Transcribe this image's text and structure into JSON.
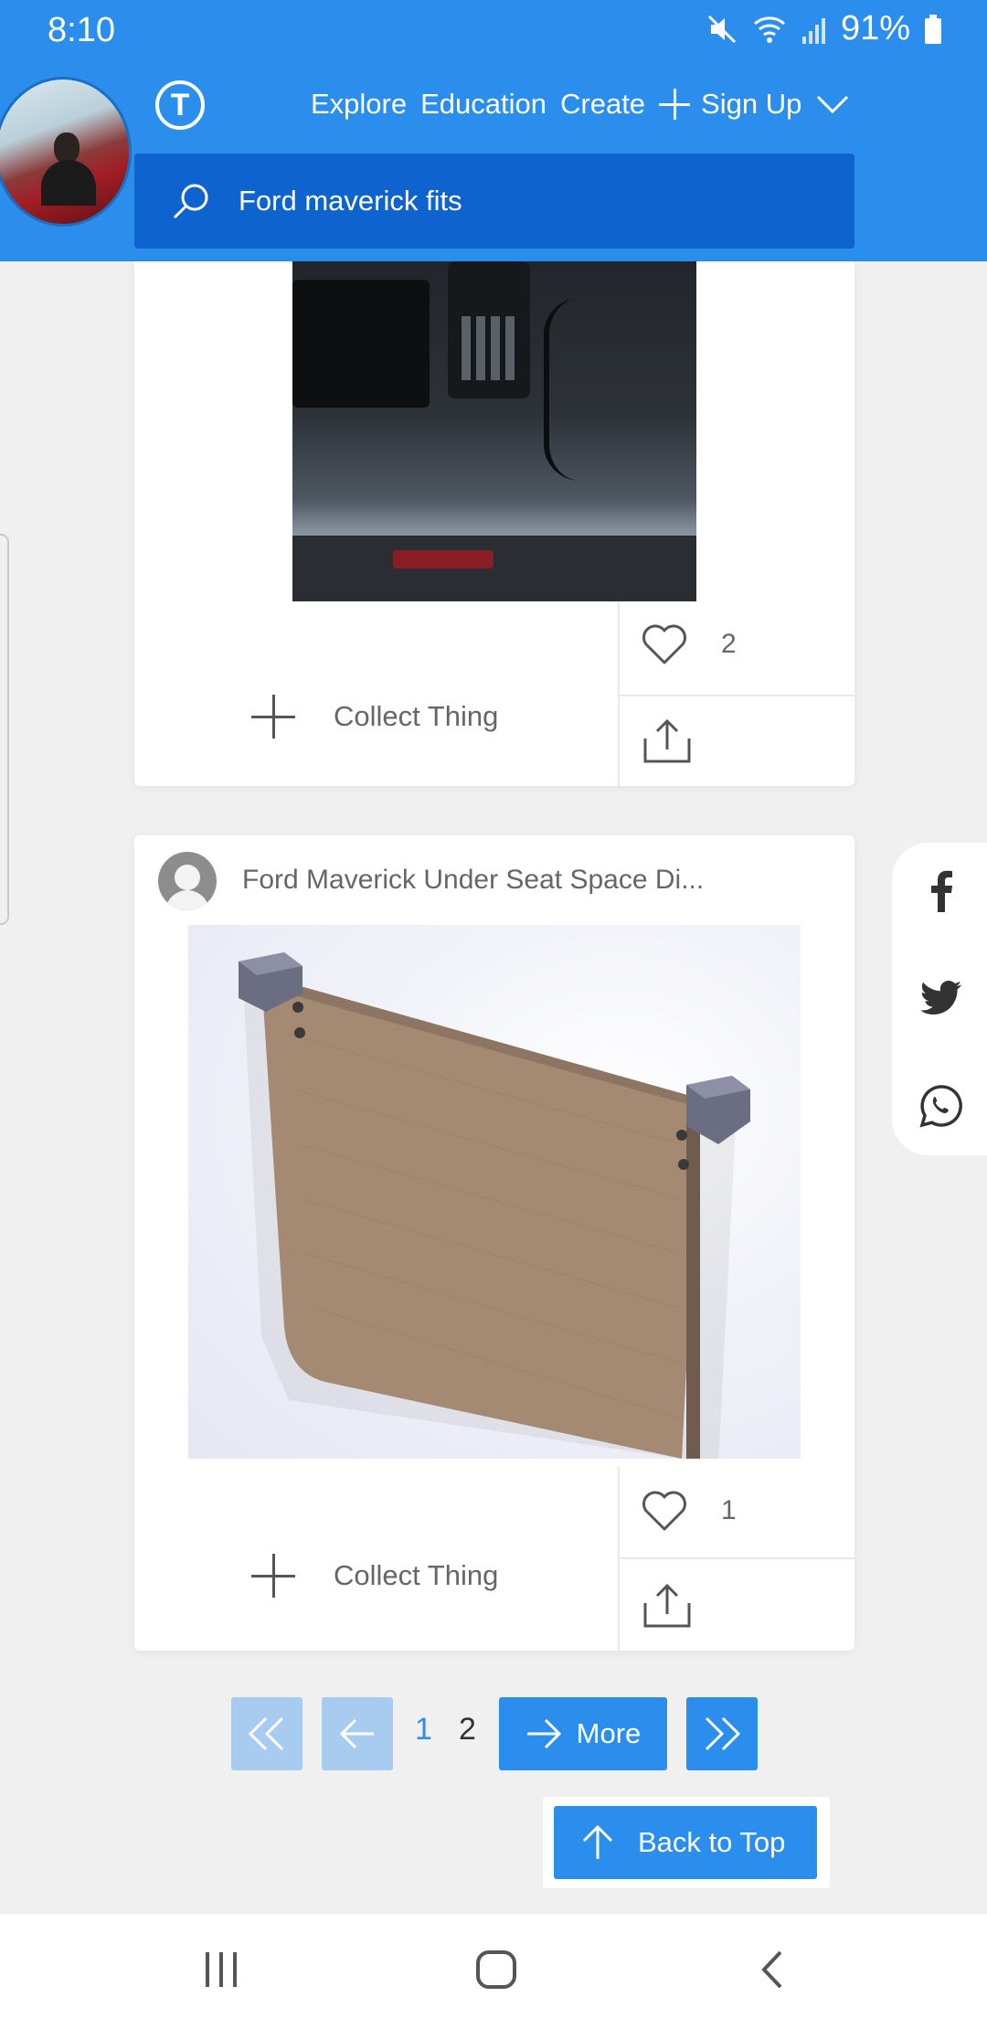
{
  "status": {
    "time": "8:10",
    "battery": "91%"
  },
  "header": {
    "logo_letter": "T",
    "nav": {
      "explore": "Explore",
      "education": "Education",
      "create": "Create",
      "signup": "Sign Up"
    },
    "search": {
      "value": "Ford maverick fits"
    }
  },
  "cards": [
    {
      "collect_label": "Collect Thing",
      "likes": "2"
    },
    {
      "title": "Ford Maverick Under Seat Space Di...",
      "collect_label": "Collect Thing",
      "likes": "1"
    }
  ],
  "pagination": {
    "pages": [
      "1",
      "2"
    ],
    "current_page": "1",
    "more_label": "More"
  },
  "back_to_top": "Back to Top",
  "colors": {
    "brand_blue": "#2b8eed",
    "search_bg": "#0e63cf"
  }
}
